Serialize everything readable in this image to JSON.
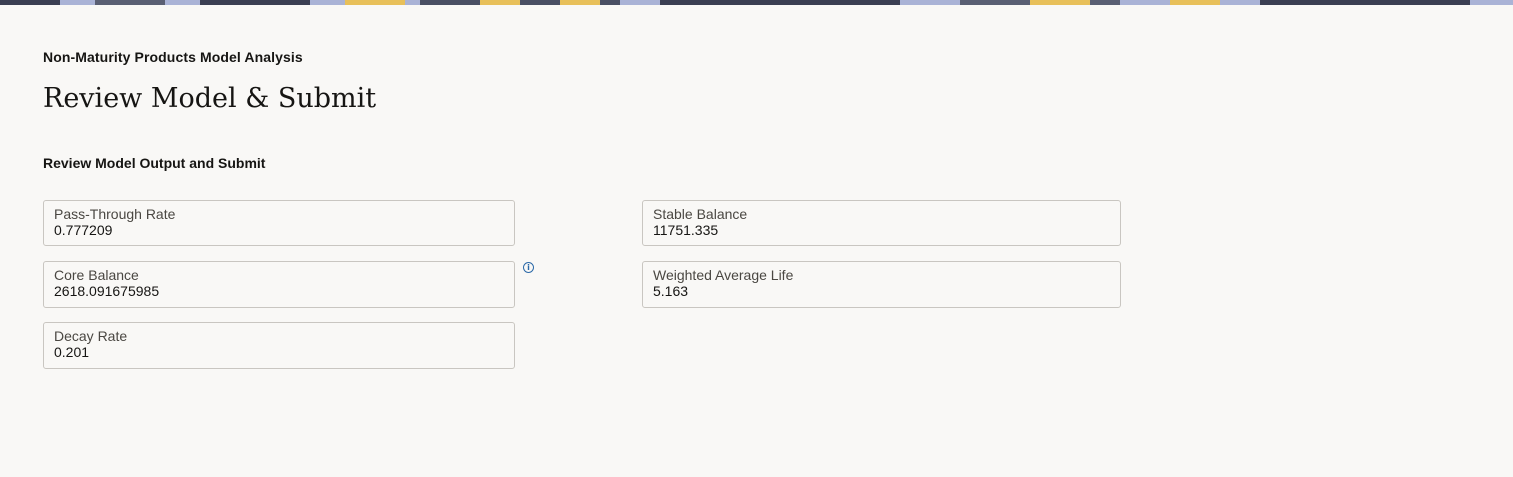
{
  "header": {
    "breadcrumb": "Non-Maturity Products Model Analysis",
    "title": "Review Model & Submit"
  },
  "section": {
    "title": "Review Model Output and Submit"
  },
  "fields": {
    "pass_through_rate": {
      "label": "Pass-Through Rate",
      "value": "0.777209"
    },
    "core_balance": {
      "label": "Core Balance",
      "value": "2618.091675985"
    },
    "decay_rate": {
      "label": "Decay Rate",
      "value": "0.201"
    },
    "stable_balance": {
      "label": "Stable Balance",
      "value": "11751.335"
    },
    "weighted_average_life": {
      "label": "Weighted Average Life",
      "value": "5.163"
    }
  },
  "icons": {
    "core_balance_info": "info-icon"
  },
  "colors": {
    "background": "#f9f8f6",
    "field_border": "#c9c6c1",
    "info_accent": "#2d6aa8",
    "banner_yellow": "#e8c05a",
    "banner_dark": "#3b3f52"
  }
}
